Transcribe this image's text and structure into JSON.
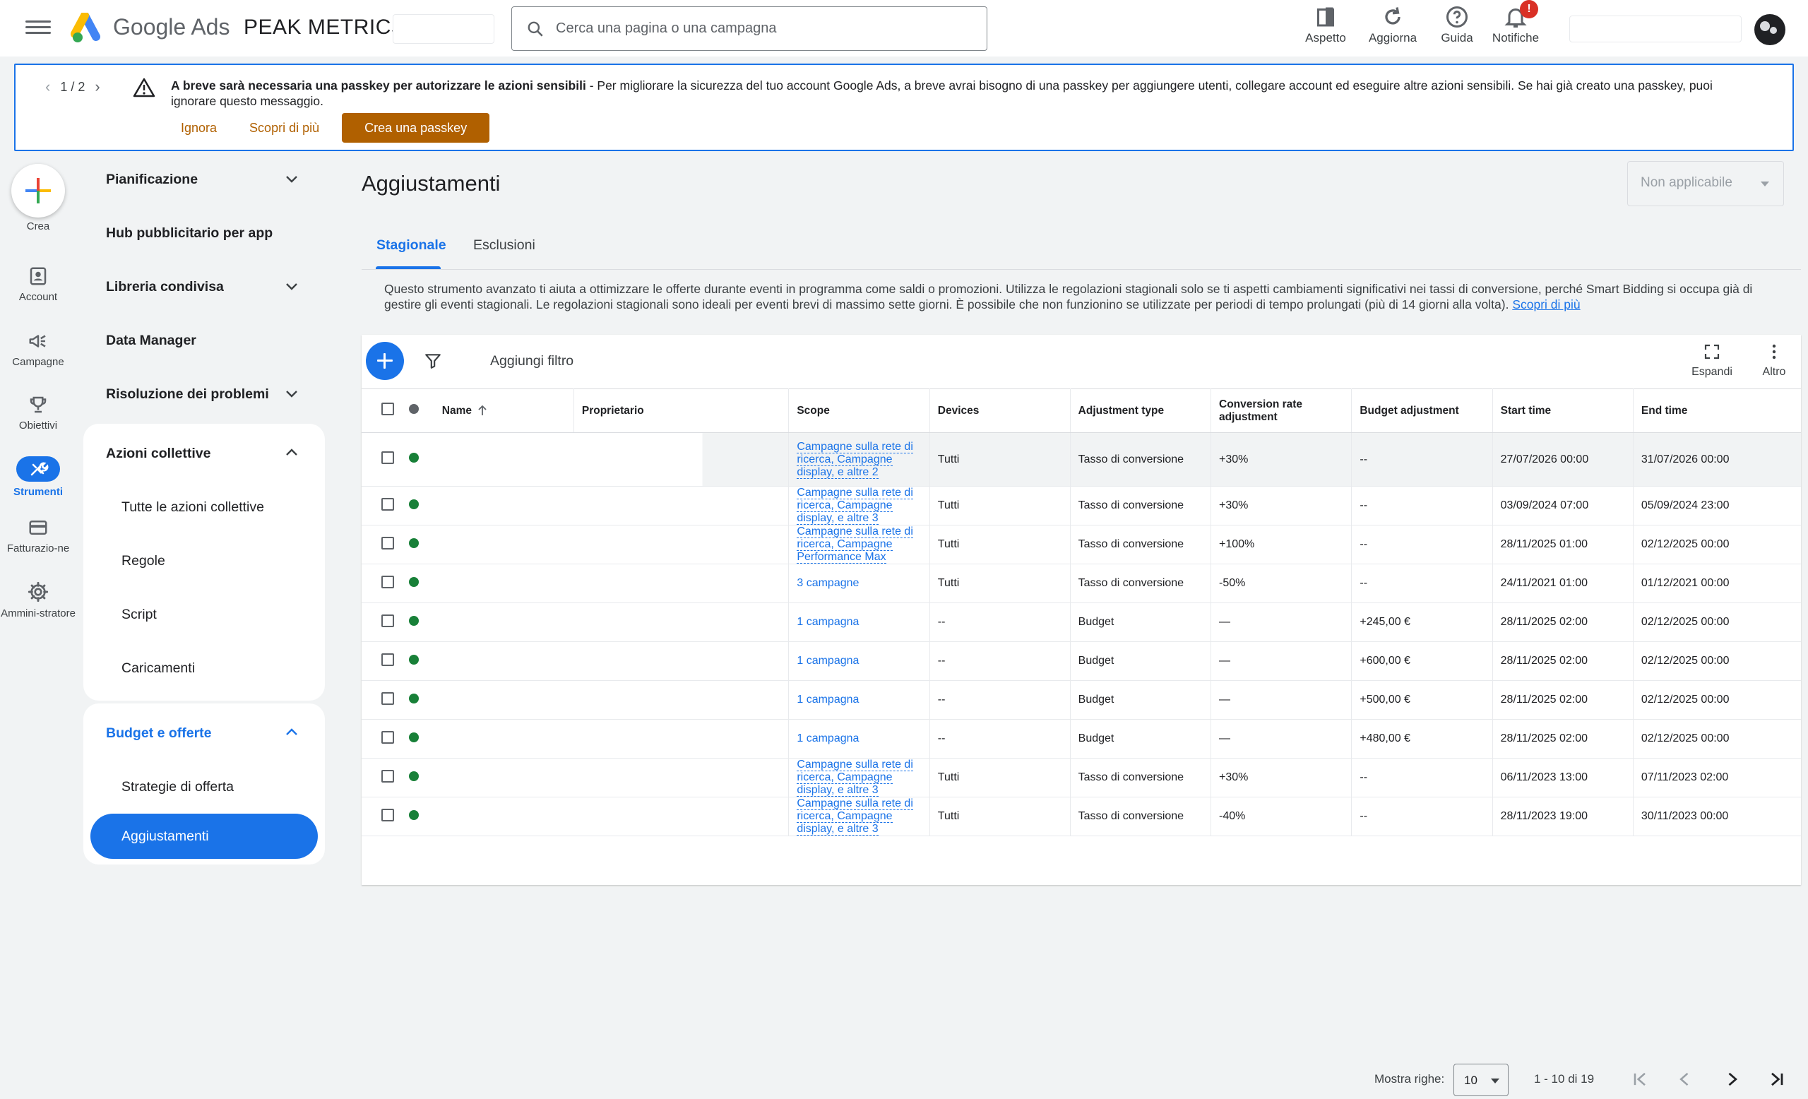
{
  "header": {
    "brand": "Google Ads",
    "account_name": "PEAK METRICS",
    "search_placeholder": "Cerca una pagina o una campagna",
    "actions": [
      {
        "label": "Aspetto",
        "icon": "appearance-icon"
      },
      {
        "label": "Aggiorna",
        "icon": "refresh-icon"
      },
      {
        "label": "Guida",
        "icon": "help-icon"
      },
      {
        "label": "Notifiche",
        "icon": "bell-icon",
        "badge": "!"
      }
    ]
  },
  "banner": {
    "pager": "1 / 2",
    "title": "A breve sarà necessaria una passkey per autorizzare le azioni sensibili",
    "text": " - Per migliorare la sicurezza del tuo account Google Ads, a breve avrai bisogno di una passkey per aggiungere utenti, collegare account ed eseguire altre azioni sensibili. Se hai già creato una passkey, puoi ignorare questo messaggio.",
    "ignore": "Ignora",
    "learn_more": "Scopri di più",
    "create": "Crea una passkey",
    "accent": "#b06000"
  },
  "rail": [
    {
      "label": "Crea",
      "icon": "plus-icon"
    },
    {
      "label": "Account",
      "icon": "account-icon"
    },
    {
      "label": "Campagne",
      "icon": "megaphone-icon"
    },
    {
      "label": "Obiettivi",
      "icon": "trophy-icon"
    },
    {
      "label": "Strumenti",
      "icon": "tools-icon",
      "active": true
    },
    {
      "label": "Fatturazio-ne",
      "icon": "billing-icon"
    },
    {
      "label": "Ammini-stratore",
      "icon": "gear-icon"
    }
  ],
  "nav": {
    "pianificazione": "Pianificazione",
    "hub": "Hub pubblicitario per app",
    "libreria": "Libreria condivisa",
    "data_manager": "Data Manager",
    "risoluzione": "Risoluzione dei problemi",
    "azioni": "Azioni collettive",
    "azioni_items": [
      "Tutte le azioni collettive",
      "Regole",
      "Script",
      "Caricamenti"
    ],
    "budget": "Budget e offerte",
    "budget_items": [
      "Strategie di offerta",
      "Aggiustamenti"
    ]
  },
  "page": {
    "title": "Aggiustamenti",
    "status_select": "Non applicabile",
    "tabs": [
      "Stagionale",
      "Esclusioni"
    ],
    "description": "Questo strumento avanzato ti aiuta a ottimizzare le offerte durante eventi in programma come saldi o promozioni. Utilizza le regolazioni stagionali solo se ti aspetti cambiamenti significativi nei tassi di conversione, perché Smart Bidding si occupa già di gestire gli eventi stagionali. Le regolazioni stagionali sono ideali per eventi brevi di massimo sette giorni. È possibile che non funzionino se utilizzate per periodi di tempo prolungati (più di 14 giorni alla volta).",
    "description_link": "Scopri di più"
  },
  "toolbar": {
    "add_filter": "Aggiungi filtro",
    "expand": "Espandi",
    "more": "Altro"
  },
  "table": {
    "columns": [
      "Name",
      "Proprietario",
      "Scope",
      "Devices",
      "Adjustment type",
      "Conversion rate adjustment",
      "Budget adjustment",
      "Start time",
      "End time"
    ],
    "rows": [
      {
        "scope": "Campagne sulla rete di ricerca, Campagne display, e altre 2",
        "devices": "Tutti",
        "type": "Tasso di conversione",
        "conv": "+30%",
        "budget": "--",
        "start": "27/07/2026 00:00",
        "end": "31/07/2026 00:00"
      },
      {
        "scope": "Campagne sulla rete di ricerca, Campagne display, e altre 3",
        "devices": "Tutti",
        "type": "Tasso di conversione",
        "conv": "+30%",
        "budget": "--",
        "start": "03/09/2024 07:00",
        "end": "05/09/2024 23:00"
      },
      {
        "scope": "Campagne sulla rete di ricerca, Campagne Performance Max",
        "devices": "Tutti",
        "type": "Tasso di conversione",
        "conv": "+100%",
        "budget": "--",
        "start": "28/11/2025 01:00",
        "end": "02/12/2025 00:00"
      },
      {
        "scope": "3 campagne",
        "devices": "Tutti",
        "type": "Tasso di conversione",
        "conv": "-50%",
        "budget": "--",
        "start": "24/11/2021 01:00",
        "end": "01/12/2021 00:00"
      },
      {
        "scope": "1 campagna",
        "devices": "--",
        "type": "Budget",
        "conv": "—",
        "budget": "+245,00 €",
        "start": "28/11/2025 02:00",
        "end": "02/12/2025 00:00"
      },
      {
        "scope": "1 campagna",
        "devices": "--",
        "type": "Budget",
        "conv": "—",
        "budget": "+600,00 €",
        "start": "28/11/2025 02:00",
        "end": "02/12/2025 00:00"
      },
      {
        "scope": "1 campagna",
        "devices": "--",
        "type": "Budget",
        "conv": "—",
        "budget": "+500,00 €",
        "start": "28/11/2025 02:00",
        "end": "02/12/2025 00:00"
      },
      {
        "scope": "1 campagna",
        "devices": "--",
        "type": "Budget",
        "conv": "—",
        "budget": "+480,00 €",
        "start": "28/11/2025 02:00",
        "end": "02/12/2025 00:00"
      },
      {
        "scope": "Campagne sulla rete di ricerca, Campagne display, e altre 3",
        "devices": "Tutti",
        "type": "Tasso di conversione",
        "conv": "+30%",
        "budget": "--",
        "start": "06/11/2023 13:00",
        "end": "07/11/2023 02:00"
      },
      {
        "scope": "Campagne sulla rete di ricerca, Campagne display, e altre 3",
        "devices": "Tutti",
        "type": "Tasso di conversione",
        "conv": "-40%",
        "budget": "--",
        "start": "28/11/2023 19:00",
        "end": "30/11/2023 00:00"
      }
    ]
  },
  "pager": {
    "rows_label": "Mostra righe:",
    "rows_value": "10",
    "range": "1 - 10 di 19"
  }
}
